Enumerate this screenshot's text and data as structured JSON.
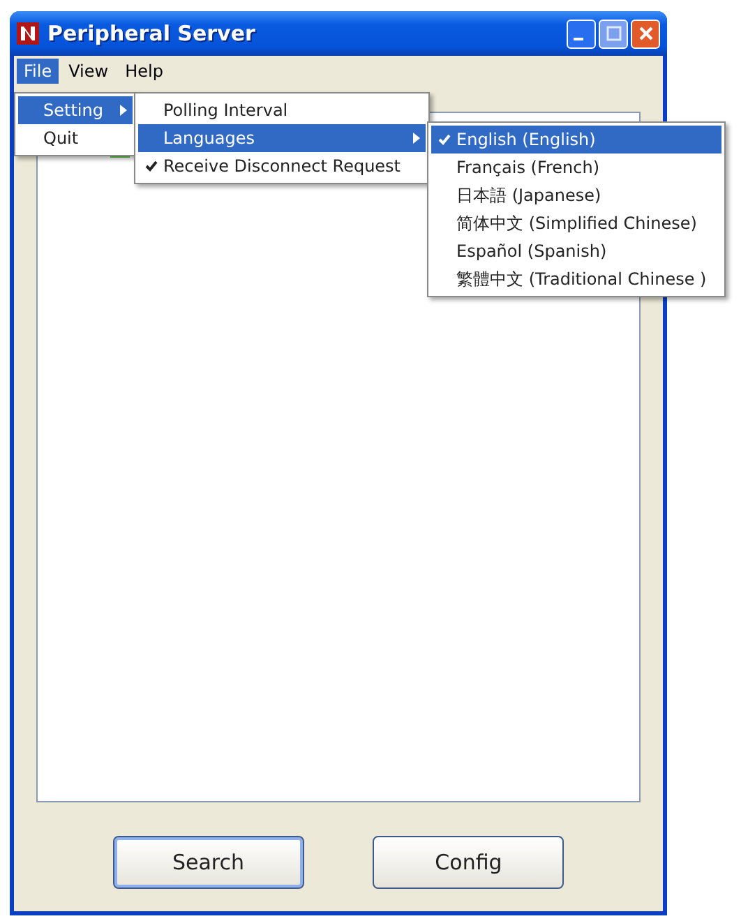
{
  "window": {
    "title": "Peripheral Server"
  },
  "menubar": [
    {
      "label": "File",
      "selected": true
    },
    {
      "label": "View",
      "selected": false
    },
    {
      "label": "Help",
      "selected": false
    }
  ],
  "file_menu": [
    {
      "label": "Setting",
      "selected": true,
      "submenu": true
    },
    {
      "label": "Quit",
      "selected": false,
      "submenu": false
    }
  ],
  "setting_menu": [
    {
      "label": "Polling Interval",
      "selected": false,
      "checked": false,
      "submenu": false
    },
    {
      "label": "Languages",
      "selected": true,
      "checked": false,
      "submenu": true
    },
    {
      "label": "Receive Disconnect Request",
      "selected": false,
      "checked": true,
      "submenu": false
    }
  ],
  "languages_menu": [
    {
      "label": "English (English)",
      "selected": true,
      "checked": true
    },
    {
      "label": "Français (French)",
      "selected": false,
      "checked": false
    },
    {
      "label": "日本語 (Japanese)",
      "selected": false,
      "checked": false
    },
    {
      "label": "简体中文 (Simplified Chinese)",
      "selected": false,
      "checked": false
    },
    {
      "label": "Español (Spanish)",
      "selected": false,
      "checked": false
    },
    {
      "label": "繁體中文 (Traditional Chinese )",
      "selected": false,
      "checked": false
    }
  ],
  "buttons": [
    {
      "label": "Search",
      "default": true
    },
    {
      "label": "Config",
      "default": false
    }
  ]
}
